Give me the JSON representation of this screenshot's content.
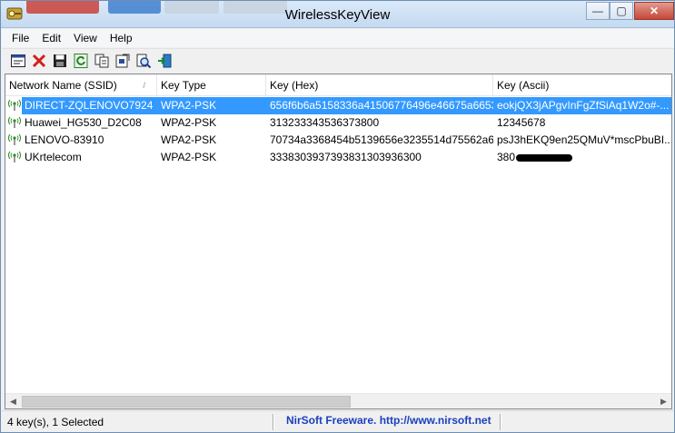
{
  "window": {
    "title": "WirelessKeyView",
    "minimize_symbol": "—",
    "maximize_symbol": "▢",
    "close_symbol": "✕"
  },
  "menu": [
    "File",
    "Edit",
    "View",
    "Help"
  ],
  "toolbar": {
    "icons": [
      "properties-icon",
      "delete-icon",
      "save-icon",
      "refresh-icon",
      "copy-icon",
      "html-report-icon",
      "find-icon",
      "exit-icon"
    ]
  },
  "list": {
    "columns": [
      "Network Name (SSID)",
      "Key Type",
      "Key (Hex)",
      "Key (Ascii)"
    ],
    "sort_indicator": "/",
    "rows": [
      {
        "ssid": "DIRECT-ZQLENOVO7924",
        "key_type": "WPA2-PSK",
        "key_hex": "656f6b6a5158336a41506776496e46675a6653...",
        "key_ascii": "eokjQX3jAPgvInFgZfSiAq1W2o#-...",
        "selected": true
      },
      {
        "ssid": "Huawei_HG530_D2C08",
        "key_type": "WPA2-PSK",
        "key_hex": "313233343536373800",
        "key_ascii": "12345678",
        "selected": false
      },
      {
        "ssid": "LENOVO-83910",
        "key_type": "WPA2-PSK",
        "key_hex": "70734a3368454b5139656e3235514d75562a6...",
        "key_ascii": "psJ3hEKQ9en25QMuV*mscPbuBI...",
        "selected": false
      },
      {
        "ssid": "UKrtelecom",
        "key_type": "WPA2-PSK",
        "key_hex": "3338303937393831303936300",
        "key_ascii": "380",
        "selected": false,
        "redacted": true
      }
    ]
  },
  "scrollbar": {
    "left_arrow": "◀",
    "right_arrow": "▶"
  },
  "status": {
    "summary": "4 key(s), 1 Selected",
    "link": "NirSoft Freeware.  http://www.nirsoft.net"
  },
  "colors": {
    "selection": "#3399ff",
    "link": "#1a3fbf"
  }
}
